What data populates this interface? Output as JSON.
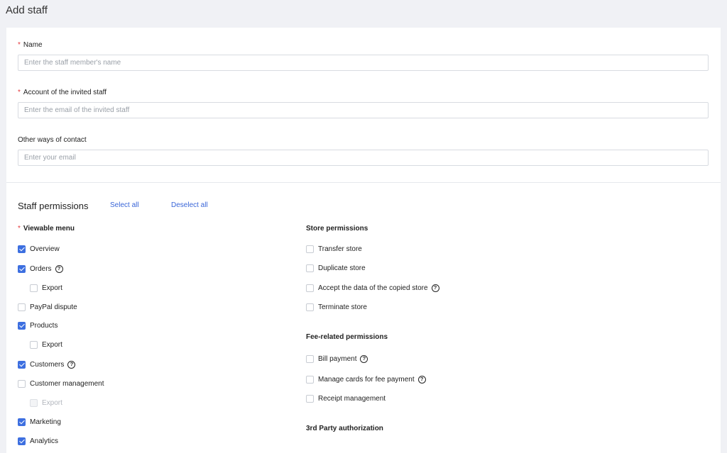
{
  "header": {
    "title": "Add staff"
  },
  "form": {
    "name": {
      "label": "Name",
      "placeholder": "Enter the staff member's name"
    },
    "account": {
      "label": "Account of the invited staff",
      "placeholder": "Enter the email of the invited staff"
    },
    "contact": {
      "label": "Other ways of contact",
      "placeholder": "Enter your email"
    }
  },
  "permissions": {
    "title": "Staff permissions",
    "select_all": "Select all",
    "deselect_all": "Deselect all",
    "viewable_menu": {
      "heading": "Viewable menu",
      "items": [
        {
          "label": "Overview",
          "checked": true
        },
        {
          "label": "Orders",
          "checked": true,
          "help": "?"
        },
        {
          "label": "Export",
          "checked": false,
          "sub": true
        },
        {
          "label": "PayPal dispute",
          "checked": false
        },
        {
          "label": "Products",
          "checked": true
        },
        {
          "label": "Export",
          "checked": false,
          "sub": true
        },
        {
          "label": "Customers",
          "checked": true,
          "help": "?"
        },
        {
          "label": "Customer management",
          "checked": false
        },
        {
          "label": "Export",
          "checked": false,
          "sub": true,
          "disabled": true
        },
        {
          "label": "Marketing",
          "checked": true
        },
        {
          "label": "Analytics",
          "checked": true
        }
      ]
    },
    "store": {
      "heading": "Store permissions",
      "items": [
        {
          "label": "Transfer store",
          "checked": false
        },
        {
          "label": "Duplicate store",
          "checked": false
        },
        {
          "label": "Accept the data of the copied store",
          "checked": false,
          "help": "?"
        },
        {
          "label": "Terminate store",
          "checked": false
        }
      ]
    },
    "fee": {
      "heading": "Fee-related permissions",
      "items": [
        {
          "label": "Bill payment",
          "checked": false,
          "help": "?"
        },
        {
          "label": "Manage cards for fee payment",
          "checked": false,
          "help": "?"
        },
        {
          "label": "Receipt management",
          "checked": false
        }
      ]
    },
    "third_party": {
      "heading": "3rd Party authorization"
    }
  }
}
